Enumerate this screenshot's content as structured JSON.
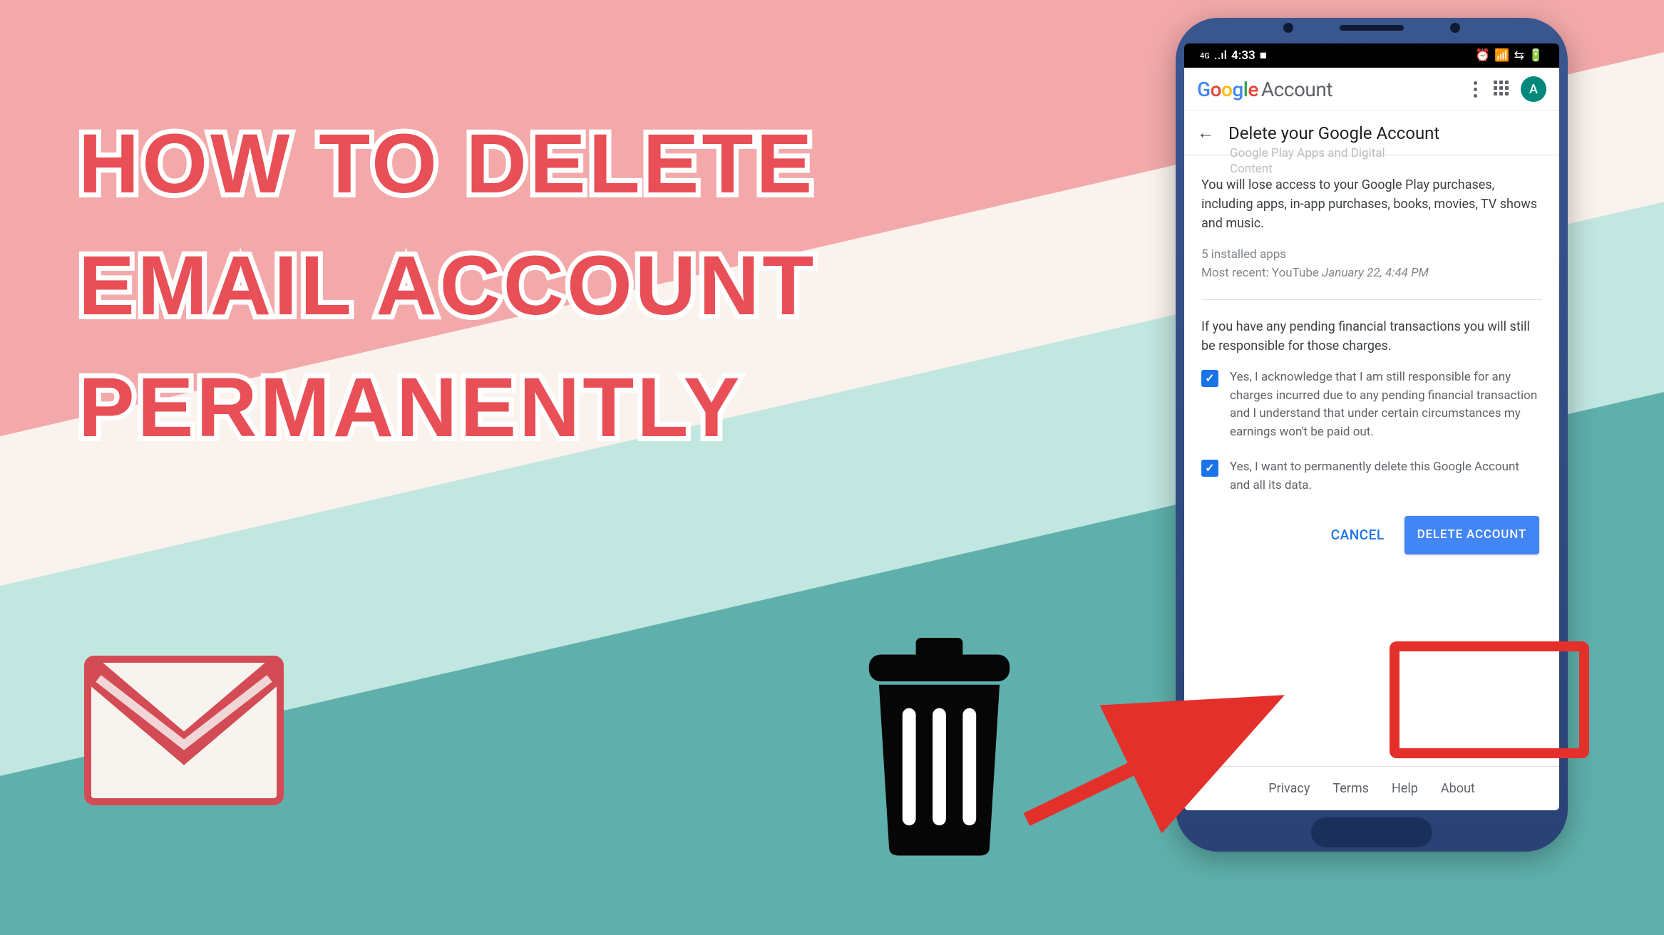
{
  "title": {
    "line1": "How To Delete",
    "line2": "email account",
    "line3": "permanently"
  },
  "statusBar": {
    "network": "4G",
    "signal": "..ıl",
    "time": "4:33",
    "videoIcon": "■",
    "rightIcons": "⏰ 📞 ⚙ 🔋"
  },
  "appHeader": {
    "brand": {
      "g": "G",
      "o1": "o",
      "o2": "o",
      "g2": "g",
      "l": "l",
      "e": "e"
    },
    "account": "Account",
    "avatarLetter": "A"
  },
  "subHeader": {
    "title": "Delete your Google Account",
    "ghost": "Google Play Apps and Digital\nContent"
  },
  "body": {
    "loseAccess": "You will lose access to your Google Play purchases, including apps, in-app purchases, books, movies, TV shows and music.",
    "installedApps": "5 installed apps",
    "mostRecentLabel": "Most recent: YouTube ",
    "mostRecentTime": "January 22, 4:44 PM",
    "pendingNote": "If you have any pending financial transactions you will still be responsible for those charges.",
    "check1": "Yes, I acknowledge that I am still responsible for any charges incurred due to any pending financial transaction and I understand that under certain circumstances my earnings won't be paid out.",
    "check2": "Yes, I want to permanently delete this Google Account and all its data."
  },
  "buttons": {
    "cancel": "CANCEL",
    "delete": "DELETE ACCOUNT"
  },
  "footer": {
    "privacy": "Privacy",
    "terms": "Terms",
    "help": "Help",
    "about": "About"
  }
}
